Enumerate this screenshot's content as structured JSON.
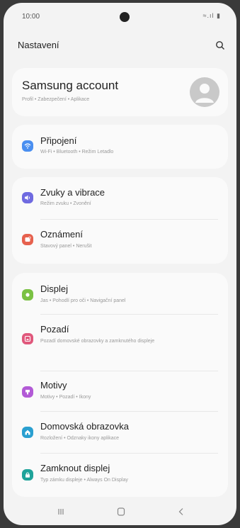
{
  "status": {
    "time": "10:00",
    "icons": "≈.ıl ▮"
  },
  "header": {
    "title": "Nastavení"
  },
  "account": {
    "title": "Samsung account",
    "subtitle": "Profil • Zabezpečení • Aplikace"
  },
  "items": [
    {
      "title": "Připojení",
      "subtitle": "Wi-Fi • Bluetooth • Režim Letadlo",
      "icon": "wifi-icon",
      "color": "#4a8ff0"
    },
    {
      "title": "Zvuky a vibrace",
      "subtitle": "Režim zvuku • Zvonění",
      "icon": "volume-icon",
      "color": "#6f6ae0"
    },
    {
      "title": "Oznámení",
      "subtitle": "Stavový panel • Nerušit",
      "icon": "notification-icon",
      "color": "#e6614e"
    },
    {
      "title": "Displej",
      "subtitle": "Jas • Pohodlí pro oči • Navigační panel",
      "icon": "brightness-icon",
      "color": "#7ac143"
    },
    {
      "title": "Pozadí",
      "subtitle": "Pozadí domovské obrazovky a zamknutého displeje",
      "icon": "wallpaper-icon",
      "color": "#e0587c"
    },
    {
      "title": "Motivy",
      "subtitle": "Motivy • Pozadí • Ikony",
      "icon": "themes-icon",
      "color": "#b25ad6"
    },
    {
      "title": "Domovská obrazovka",
      "subtitle": "Rozložení • Odznaky ikony aplikace",
      "icon": "home-icon",
      "color": "#2a9fd0"
    },
    {
      "title": "Zamknout displej",
      "subtitle": "Typ zámku displeje • Always On Display",
      "icon": "lock-icon",
      "color": "#1fa39a"
    }
  ],
  "navbar": {
    "recent": "recent-apps-icon",
    "home": "home-button-icon",
    "back": "back-icon"
  }
}
